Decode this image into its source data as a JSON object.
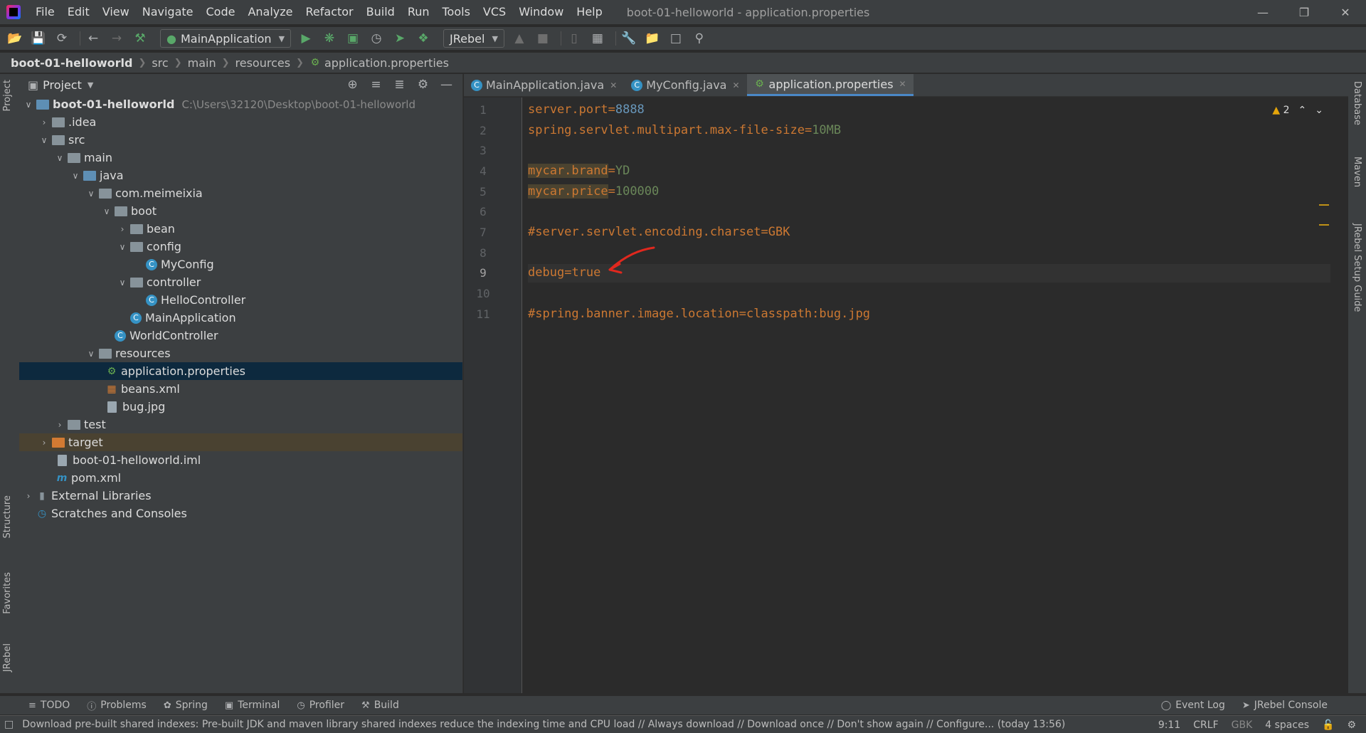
{
  "window": {
    "menu": [
      "File",
      "Edit",
      "View",
      "Navigate",
      "Code",
      "Analyze",
      "Refactor",
      "Build",
      "Run",
      "Tools",
      "VCS",
      "Window",
      "Help"
    ],
    "title": "boot-01-helloworld - application.properties"
  },
  "toolbar": {
    "run_config": "MainApplication",
    "jrebel_config": "JRebel"
  },
  "breadcrumb": [
    "boot-01-helloworld",
    "src",
    "main",
    "resources",
    "application.properties"
  ],
  "project_panel": {
    "title": "Project",
    "root": {
      "name": "boot-01-helloworld",
      "path": "C:\\Users\\32120\\Desktop\\boot-01-helloworld"
    },
    "nodes": [
      ".idea",
      "src",
      "main",
      "java",
      "com.meimeixia",
      "boot",
      "bean",
      "config",
      "MyConfig",
      "controller",
      "HelloController",
      "MainApplication",
      "WorldController",
      "resources",
      "application.properties",
      "beans.xml",
      "bug.jpg",
      "test",
      "target",
      "boot-01-helloworld.iml",
      "pom.xml",
      "External Libraries",
      "Scratches and Consoles"
    ]
  },
  "tabs": [
    "MainApplication.java",
    "MyConfig.java",
    "application.properties"
  ],
  "editor": {
    "line_numbers": [
      "1",
      "2",
      "3",
      "4",
      "5",
      "6",
      "7",
      "8",
      "9",
      "10",
      "11"
    ],
    "lines": {
      "l1_key": "server.port",
      "l1_val": "8888",
      "l2_key": "spring.servlet.multipart.max-file-size",
      "l2_val": "10MB",
      "l4_key": "mycar.brand",
      "l4_val": "YD",
      "l5_key": "mycar.price",
      "l5_val": "100000",
      "l7": "#server.servlet.encoding.charset=GBK",
      "l9_key": "debug",
      "l9_val": "true",
      "l11": "#spring.banner.image.location=classpath:bug.jpg"
    },
    "equals": "=",
    "warnings_count": "2"
  },
  "left_strip": [
    "Project",
    "Structure",
    "Favorites",
    "JRebel"
  ],
  "right_strip": [
    "Database",
    "Maven",
    "JRebel Setup Guide"
  ],
  "bottom_tools": {
    "left": [
      "TODO",
      "Problems",
      "Spring",
      "Terminal",
      "Profiler",
      "Build"
    ],
    "right": [
      "Event Log",
      "JRebel Console"
    ]
  },
  "status": {
    "message": "Download pre-built shared indexes: Pre-built JDK and maven library shared indexes reduce the indexing time and CPU load // Always download // Download once // Don't show again // Configure... (today 13:56)",
    "position": "9:11",
    "line_sep": "CRLF",
    "encoding": "GBK",
    "indent": "4 spaces"
  },
  "colors": {
    "key": "#cc7832",
    "value": "#6a8759",
    "number": "#6897bb",
    "annotation": "#e0281e",
    "selection": "#0d293e"
  }
}
